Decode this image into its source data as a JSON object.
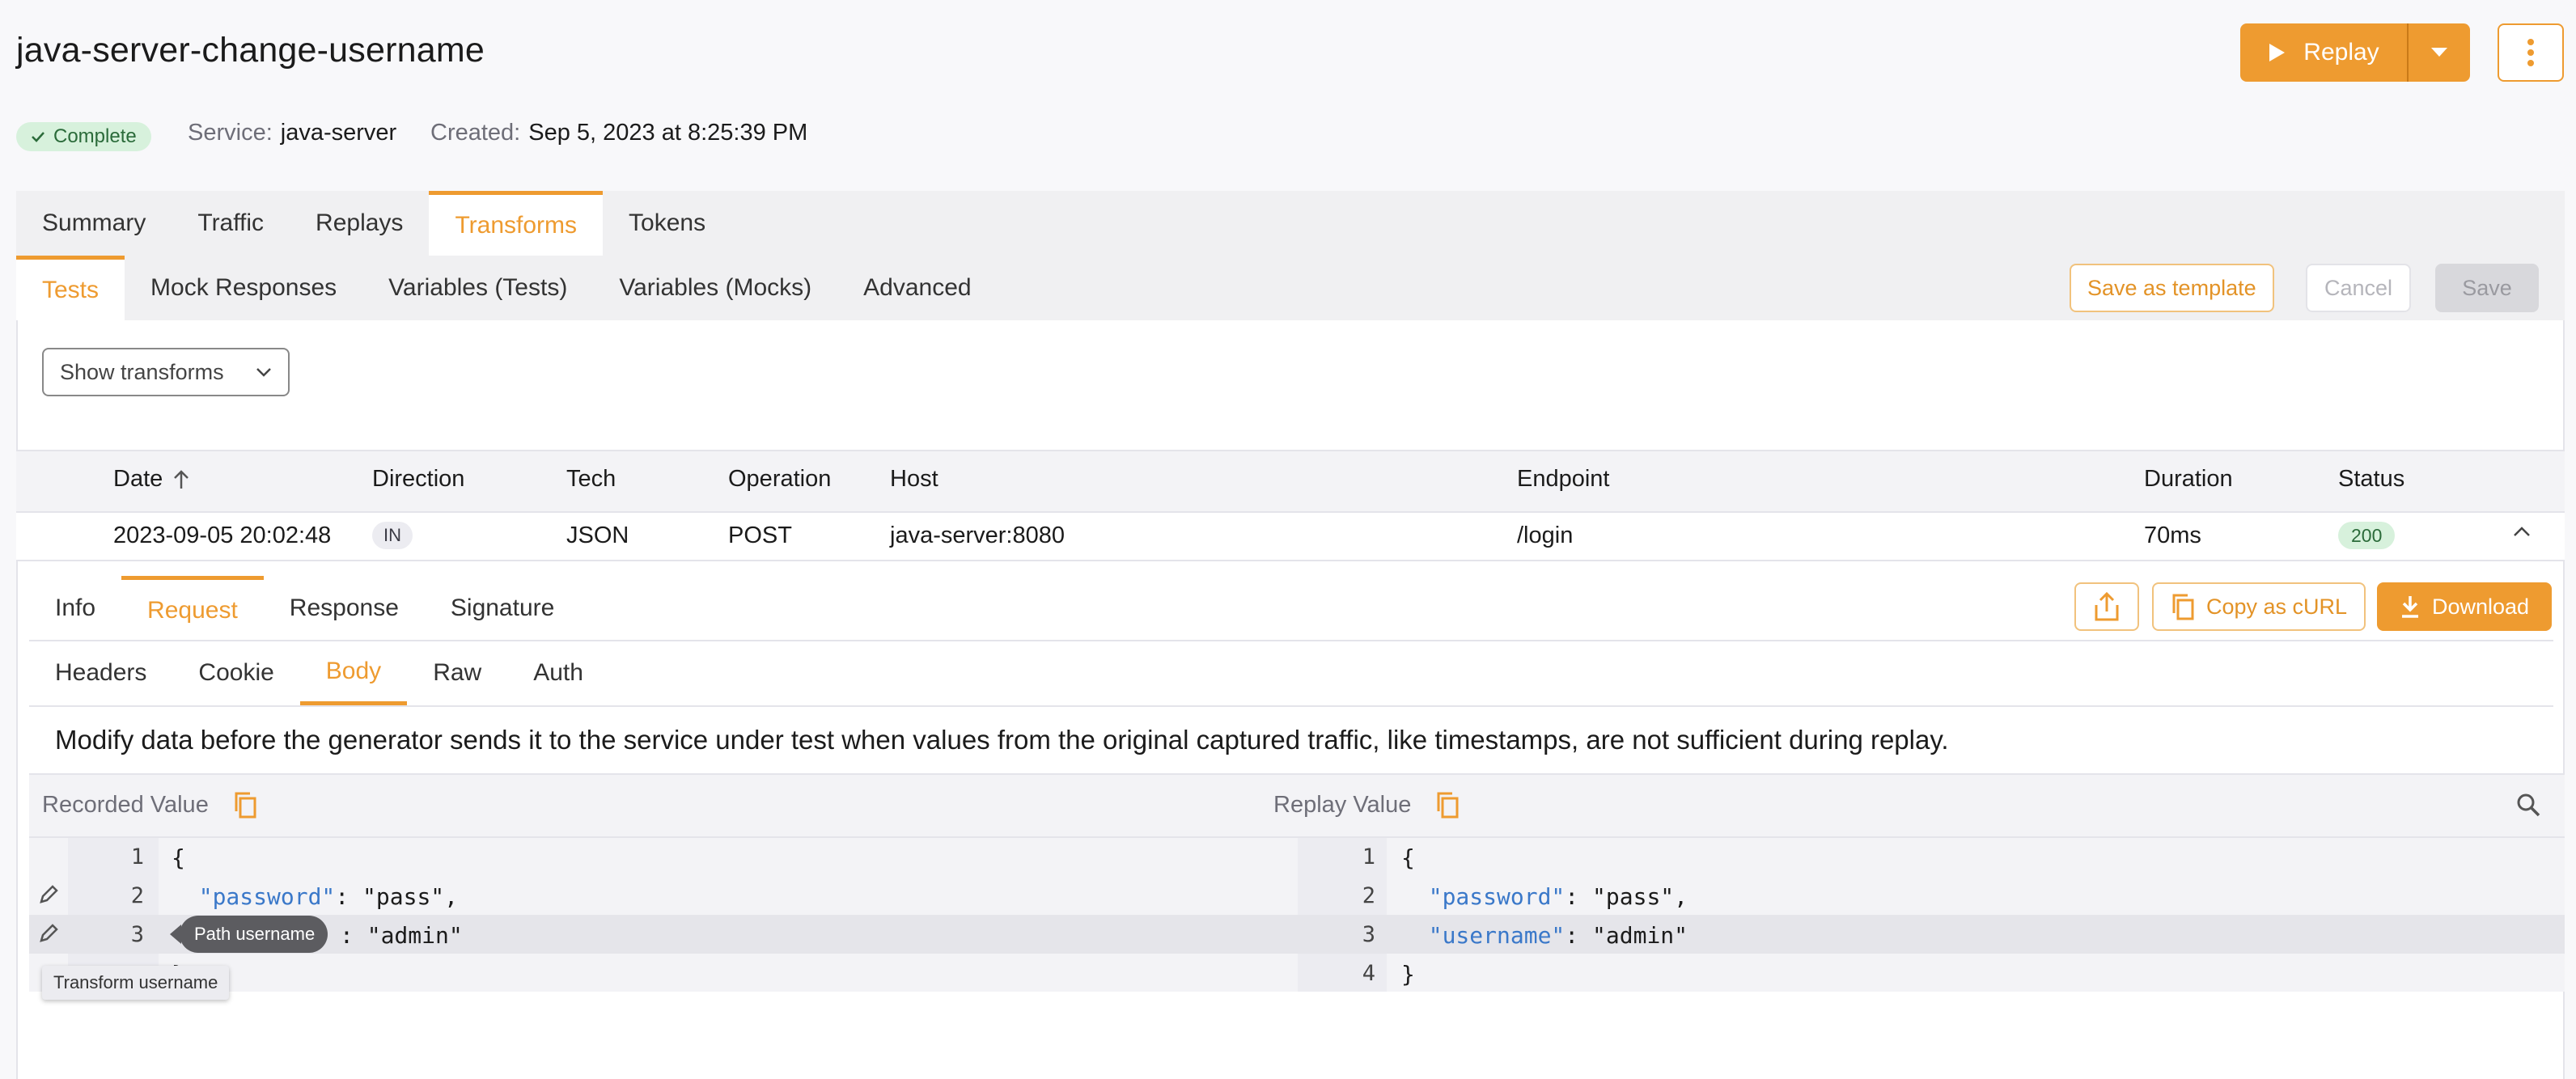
{
  "header": {
    "title": "java-server-change-username",
    "replay_label": "Replay",
    "status": "Complete",
    "service_key": "Service:",
    "service_value": "java-server",
    "created_key": "Created:",
    "created_value": "Sep 5, 2023 at 8:25:39 PM"
  },
  "main_tabs": [
    "Summary",
    "Traffic",
    "Replays",
    "Transforms",
    "Tokens"
  ],
  "transform_tabs": [
    "Tests",
    "Mock Responses",
    "Variables (Tests)",
    "Variables (Mocks)",
    "Advanced"
  ],
  "actions": {
    "save_template": "Save as template",
    "cancel": "Cancel",
    "save": "Save"
  },
  "show_transforms": "Show transforms",
  "table": {
    "headers": [
      "Date",
      "Direction",
      "Tech",
      "Operation",
      "Host",
      "Endpoint",
      "Duration",
      "Status"
    ],
    "row": {
      "date": "2023-09-05 20:02:48",
      "direction": "IN",
      "tech": "JSON",
      "operation": "POST",
      "host": "java-server:8080",
      "endpoint": "/login",
      "duration": "70ms",
      "status": "200"
    }
  },
  "detail_tabs": [
    "Info",
    "Request",
    "Response",
    "Signature"
  ],
  "request_tabs": [
    "Headers",
    "Cookie",
    "Body",
    "Raw",
    "Auth"
  ],
  "detail_actions": {
    "copy_curl": "Copy as cURL",
    "download": "Download"
  },
  "description": "Modify data before the generator sends it to the service under test when values from the original captured traffic, like timestamps, are not sufficient during replay.",
  "values": {
    "recorded_label": "Recorded Value",
    "replay_label": "Replay Value"
  },
  "recorded_lines": {
    "l1": "{",
    "l2_key": "\"password\"",
    "l2_rest": ": \"pass\",",
    "l3_rest": ": \"admin\"",
    "l4": "}"
  },
  "replay_lines": {
    "l1": "{",
    "l2_key": "\"password\"",
    "l2_rest": ": \"pass\",",
    "l3_key": "\"username\"",
    "l3_rest": ": \"admin\"",
    "l4": "}"
  },
  "tooltips": {
    "path": "Path username",
    "transform": "Transform username"
  },
  "colors": {
    "accent": "#ee9b30",
    "success_bg": "#d7f1dc",
    "json_key": "#3a78c9"
  }
}
